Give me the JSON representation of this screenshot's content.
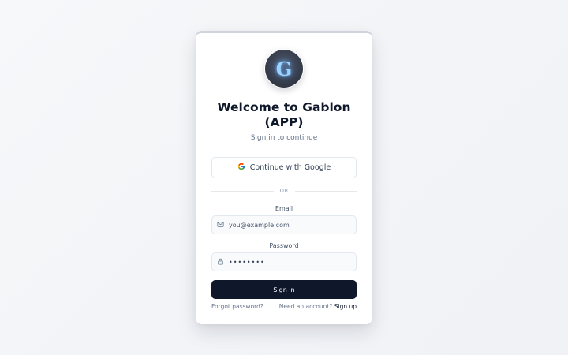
{
  "card": {
    "logo_letter": "G",
    "title": "Welcome to Gablon (APP)",
    "subtitle": "Sign in to continue"
  },
  "oauth": {
    "google_label": "Continue with Google",
    "google_icon": "google-g-icon"
  },
  "divider": {
    "label": "OR"
  },
  "email": {
    "label": "Email",
    "placeholder": "you@example.com",
    "value": "",
    "icon": "mail-icon"
  },
  "password": {
    "label": "Password",
    "value": "••••••••",
    "icon": "lock-icon"
  },
  "signin": {
    "label": "Sign in"
  },
  "footer": {
    "forgot_label": "Forgot password?",
    "account_prompt": "Need an account?",
    "signup_label": "Sign up"
  },
  "colors": {
    "primary": "#0f172a",
    "muted_text": "#64748b",
    "border": "#e2e8f0",
    "logo_glow": "#9cd2ff"
  }
}
